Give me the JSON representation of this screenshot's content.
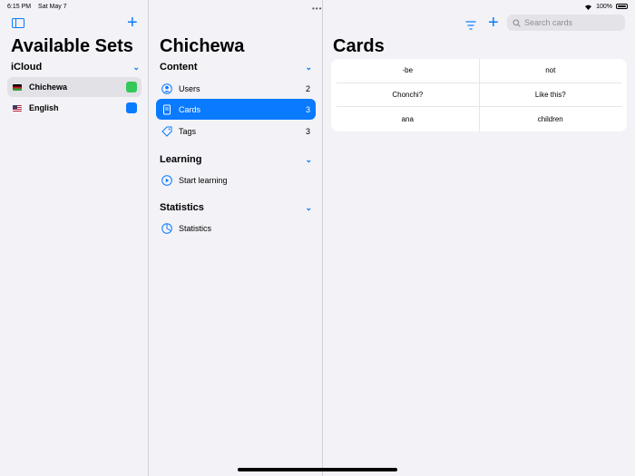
{
  "status_bar": {
    "time": "6:15 PM",
    "date": "Sat May 7",
    "battery": "100%"
  },
  "sets_pane": {
    "title": "Available Sets",
    "section": "iCloud",
    "sets": [
      {
        "name": "Chichewa",
        "flag": "malawi-flag",
        "color": "#34c759"
      },
      {
        "name": "English",
        "flag": "us-flag",
        "color": "#0a7aff"
      }
    ]
  },
  "nav_pane": {
    "title": "Chichewa",
    "sections": [
      {
        "header": "Content",
        "items": [
          {
            "label": "Users",
            "count": "2",
            "icon": "person-circle-icon"
          },
          {
            "label": "Cards",
            "count": "3",
            "icon": "card-icon"
          },
          {
            "label": "Tags",
            "count": "3",
            "icon": "tag-icon"
          }
        ]
      },
      {
        "header": "Learning",
        "items": [
          {
            "label": "Start learning",
            "icon": "play-circle-icon"
          }
        ]
      },
      {
        "header": "Statistics",
        "items": [
          {
            "label": "Statistics",
            "icon": "chart-pie-icon"
          }
        ]
      }
    ]
  },
  "cards_pane": {
    "title": "Cards",
    "search_placeholder": "Search cards",
    "cards": [
      {
        "front": "-be",
        "back": "not"
      },
      {
        "front": "Chonchi?",
        "back": "Like this?"
      },
      {
        "front": "ana",
        "back": "children"
      }
    ]
  },
  "colors": {
    "accent": "#0a7aff",
    "background": "#f2f2f7"
  }
}
